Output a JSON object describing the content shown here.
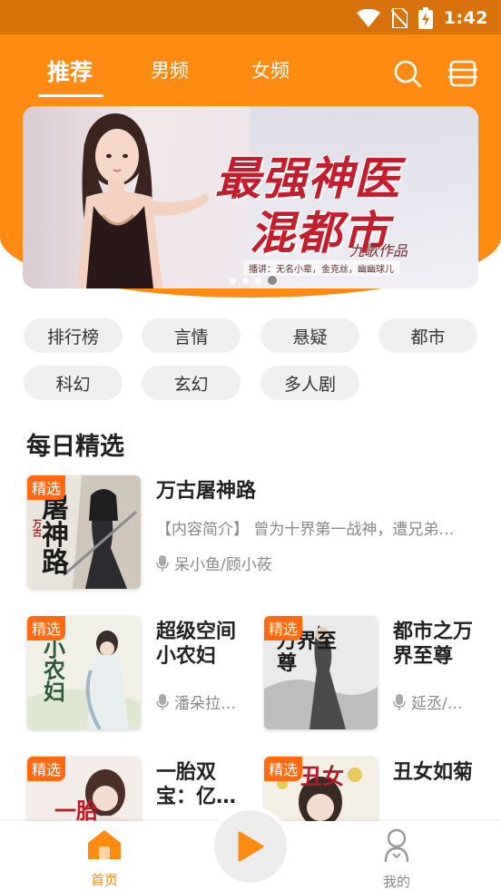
{
  "status_bar": {
    "time": "1:42"
  },
  "tabs": [
    {
      "label": "推荐",
      "active": true
    },
    {
      "label": "男频",
      "active": false
    },
    {
      "label": "女频",
      "active": false
    }
  ],
  "header_icons": [
    "search-icon",
    "bookshelf-icon"
  ],
  "banner": {
    "title_line1": "最强神医",
    "title_line2": "混都市",
    "author": "九歌作品",
    "narrator": "播讲：无名小辈，金克丝，幽幽球儿",
    "slide_count": 4,
    "active_slide": 4
  },
  "categories": [
    "排行榜",
    "言情",
    "悬疑",
    "都市",
    "科幻",
    "玄幻",
    "多人剧"
  ],
  "section": {
    "title": "每日精选"
  },
  "featured_book": {
    "badge": "精选",
    "title": "万古屠神路",
    "description": "【内容简介】 曾为十界第一战神，遭兄弟…",
    "author": "呆小鱼/顾小莜",
    "cover_text": "屠神路",
    "cover_subtext": "万古"
  },
  "books": [
    {
      "badge": "精选",
      "title": "超级空间小农妇",
      "author": "潘朵拉…",
      "cover_text": "小农妇"
    },
    {
      "badge": "精选",
      "title": "都市之万界至尊",
      "author": "延丞/…",
      "cover_text": "万界至尊"
    },
    {
      "badge": "精选",
      "title": "一胎双宝：亿…",
      "author": "",
      "cover_text": "一胎"
    },
    {
      "badge": "精选",
      "title": "丑女如菊",
      "author": "",
      "cover_text": "丑女"
    }
  ],
  "bottom_nav": {
    "home_label": "首页",
    "mine_label": "我的",
    "accent": "#ff8a12",
    "inactive": "#888888"
  },
  "colors": {
    "primary": "#ff8a12",
    "status_bar": "#d9720b",
    "badge": "#ff6a10"
  }
}
